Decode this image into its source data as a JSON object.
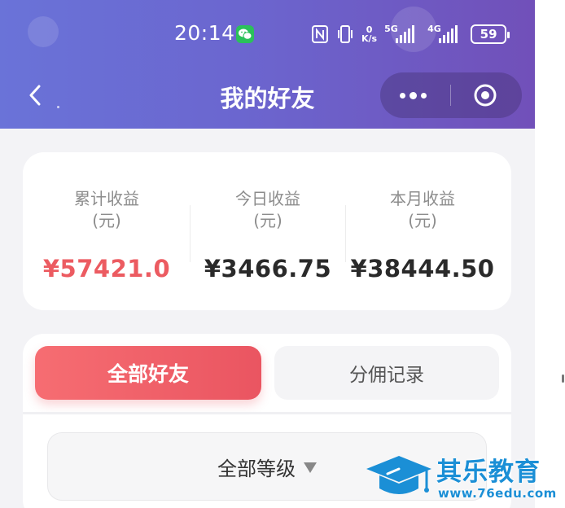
{
  "status_bar": {
    "time": "20:14",
    "speed_top": "0",
    "speed_bottom": "K/s",
    "net1": "5G",
    "net2": "4G",
    "battery": "59"
  },
  "nav": {
    "title": "我的好友"
  },
  "earnings": [
    {
      "label_line1": "累计收益",
      "label_line2": "(元)",
      "value": "¥57421.0",
      "color": "#ec5b61"
    },
    {
      "label_line1": "今日收益",
      "label_line2": "(元)",
      "value": "¥3466.75",
      "color": "#2a2a2a"
    },
    {
      "label_line1": "本月收益",
      "label_line2": "(元)",
      "value": "¥38444.50",
      "color": "#2a2a2a"
    }
  ],
  "tabs": {
    "active": "全部好友",
    "inactive": "分佣记录"
  },
  "filter": {
    "level": "全部等级"
  },
  "watermark": {
    "name": "其乐教育",
    "url": "www.76edu.com"
  },
  "colors": {
    "header_start": "#6a73d8",
    "header_end": "#7150b9",
    "accent_red": "#ec5b61",
    "watermark_blue": "#1b8fd6"
  }
}
